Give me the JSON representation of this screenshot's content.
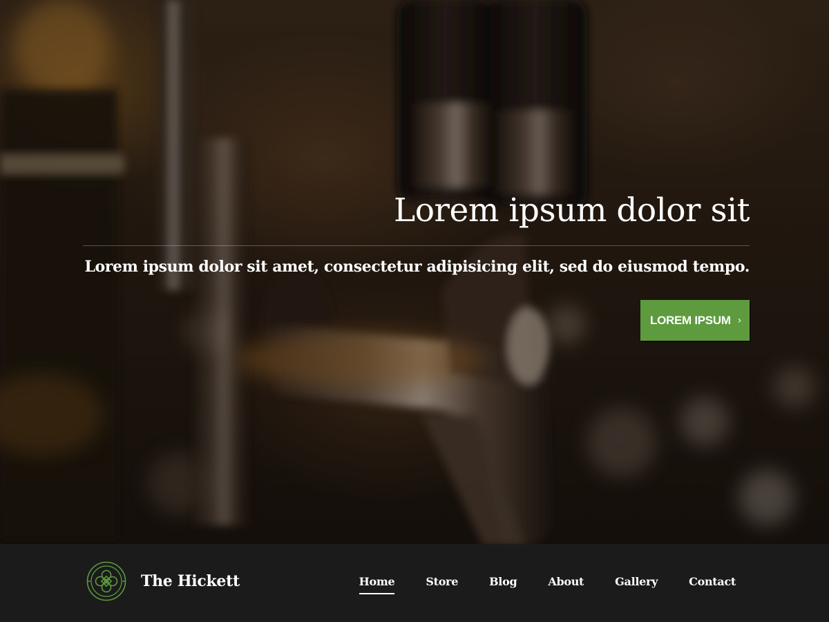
{
  "hero": {
    "title": "Lorem ipsum dolor sit",
    "subtitle": "Lorem ipsum dolor sit amet, consectetur adipisicing elit, sed do eiusmod tempo.",
    "cta_label": "LOREM IPSUM",
    "cta_icon": "chevron-right-icon",
    "background": "blurred-beer-tap-photo"
  },
  "brand": {
    "name": "The Hickett",
    "logo_icon": "celtic-knot-logo"
  },
  "nav": {
    "items": [
      {
        "label": "Home",
        "active": true
      },
      {
        "label": "Store",
        "active": false
      },
      {
        "label": "Blog",
        "active": false
      },
      {
        "label": "About",
        "active": false
      },
      {
        "label": "Gallery",
        "active": false
      },
      {
        "label": "Contact",
        "active": false
      }
    ]
  },
  "colors": {
    "accent_green": "#5e9b3f",
    "navbar_bg": "#1c1c1c",
    "text": "#ffffff"
  }
}
